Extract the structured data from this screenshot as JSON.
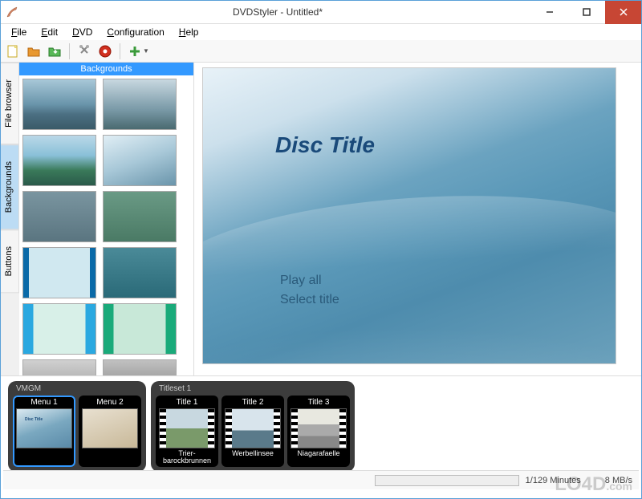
{
  "window": {
    "title": "DVDStyler - Untitled*"
  },
  "menu": {
    "file": "File",
    "edit": "Edit",
    "dvd": "DVD",
    "configuration": "Configuration",
    "help": "Help"
  },
  "toolbar_icons": {
    "new": "new-icon",
    "open": "open-icon",
    "save": "save-icon",
    "settings": "settings-icon",
    "burn": "burn-icon",
    "add": "add-icon"
  },
  "side_tabs": {
    "file_browser": "File browser",
    "backgrounds": "Backgrounds",
    "buttons": "Buttons"
  },
  "panel": {
    "header": "Backgrounds"
  },
  "preview": {
    "disc_title": "Disc Title",
    "play_all": "Play all",
    "select_title": "Select title"
  },
  "timeline": {
    "vmgm": {
      "label": "VMGM",
      "items": [
        {
          "title": "Menu 1"
        },
        {
          "title": "Menu 2"
        }
      ]
    },
    "titleset1": {
      "label": "Titleset 1",
      "items": [
        {
          "title": "Title 1",
          "caption": "Trier-barockbrunnen"
        },
        {
          "title": "Title 2",
          "caption": "Werbellinsee"
        },
        {
          "title": "Title 3",
          "caption": "Niagarafaelle"
        }
      ]
    }
  },
  "status": {
    "minutes": "1/129 Minutes",
    "bitrate": "8 MB/s"
  },
  "watermark": "LO4D.com"
}
